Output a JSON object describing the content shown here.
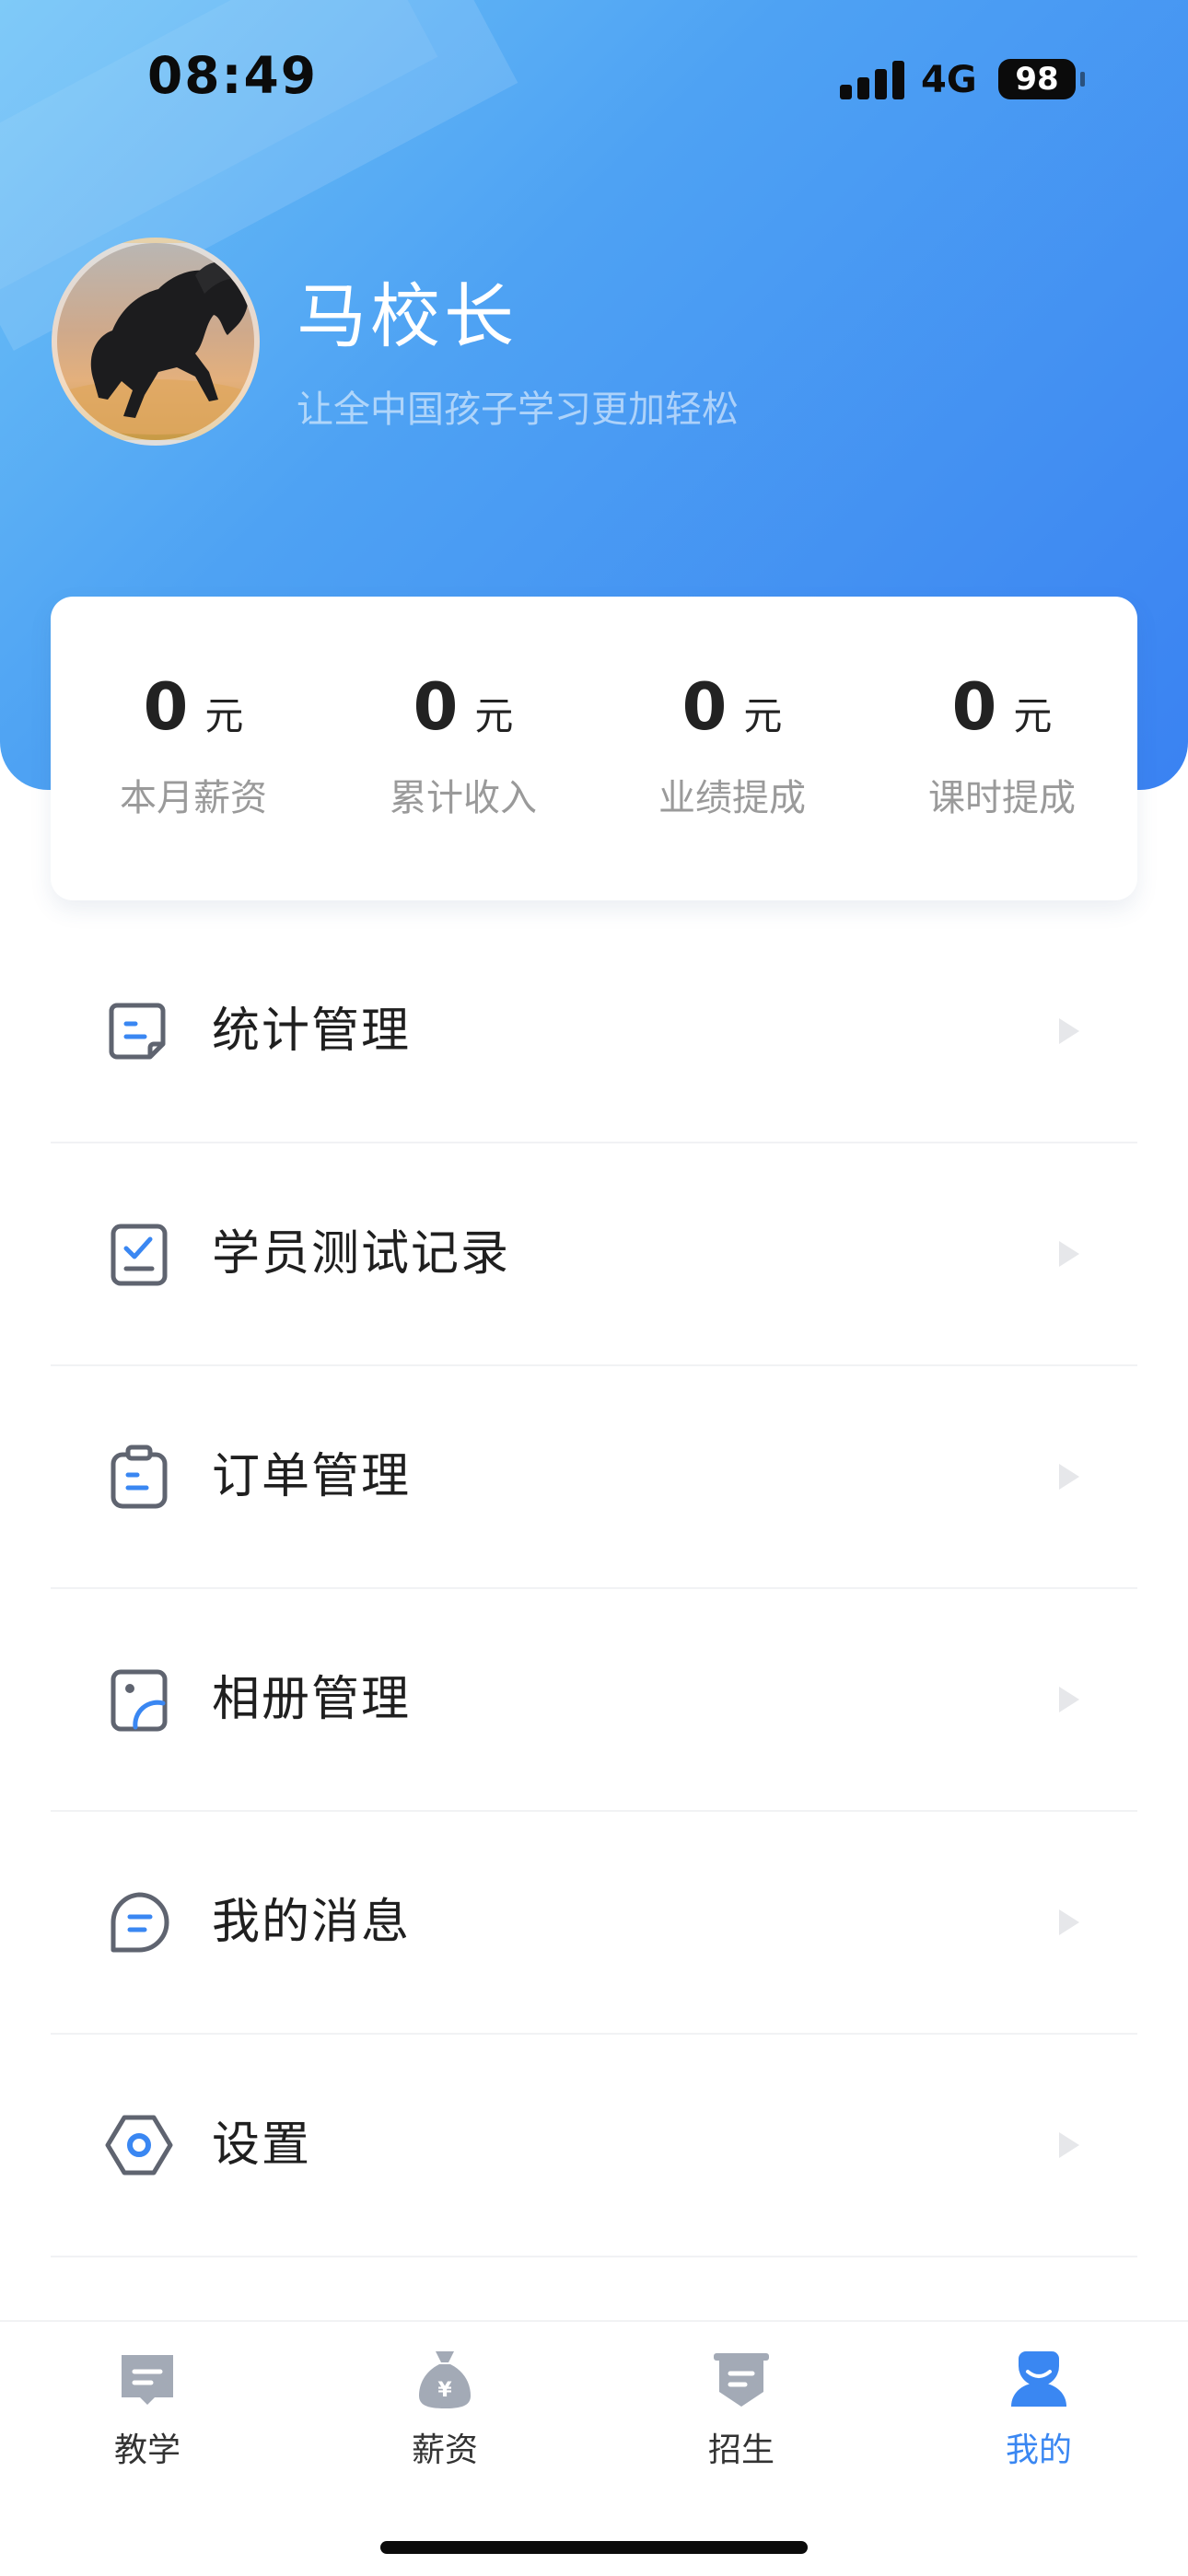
{
  "status_bar": {
    "time": "08:49",
    "network": "4G",
    "battery": "98"
  },
  "profile": {
    "name": "马校长",
    "motto": "让全中国孩子学习更加轻松",
    "avatar_icon": "black-horse-avatar"
  },
  "stats": [
    {
      "value": "0",
      "unit": "元",
      "label": "本月薪资"
    },
    {
      "value": "0",
      "unit": "元",
      "label": "累计收入"
    },
    {
      "value": "0",
      "unit": "元",
      "label": "业绩提成"
    },
    {
      "value": "0",
      "unit": "元",
      "label": "课时提成"
    }
  ],
  "menu": [
    {
      "label": "统计管理",
      "icon": "statistics-doc-icon"
    },
    {
      "label": "学员测试记录",
      "icon": "test-record-icon"
    },
    {
      "label": "订单管理",
      "icon": "clipboard-icon"
    },
    {
      "label": "相册管理",
      "icon": "album-icon"
    },
    {
      "label": "我的消息",
      "icon": "message-icon"
    },
    {
      "label": "设置",
      "icon": "settings-hexagon-icon"
    }
  ],
  "tabbar": [
    {
      "label": "教学",
      "icon": "teaching-icon",
      "active": false
    },
    {
      "label": "薪资",
      "icon": "money-bag-icon",
      "active": false
    },
    {
      "label": "招生",
      "icon": "enrollment-icon",
      "active": false
    },
    {
      "label": "我的",
      "icon": "user-icon",
      "active": true
    }
  ],
  "colors": {
    "accent": "#3a87f2",
    "header_gradient_start": "#6ec3f7",
    "header_gradient_end": "#3a82f2",
    "tab_inactive": "#a3aab6",
    "label_gray": "#9a9a9a"
  }
}
